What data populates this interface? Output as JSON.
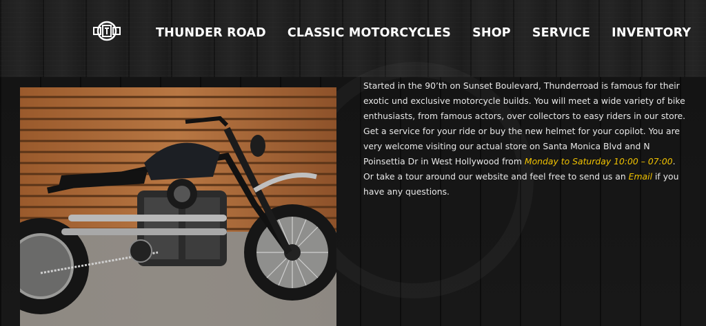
{
  "nav": {
    "items": [
      {
        "label": "THUNDER ROAD"
      },
      {
        "label": "CLASSIC MOTORCYCLES"
      },
      {
        "label": "SHOP"
      },
      {
        "label": "SERVICE"
      },
      {
        "label": "INVENTORY"
      }
    ]
  },
  "logo": {
    "icon": "thunderroad-crest-icon"
  },
  "photo": {
    "subject": "motorcycle-photo"
  },
  "intro": {
    "part1": "Started in the 90’th on Sunset Boulevard, Thunderroad is famous for their exotic und exclusive motorcycle builds. You will meet a wide variety of bike enthusiasts, from famous actors, over collectors to easy riders in our store. Get a service for your ride or buy the new helmet for your copilot. You are very welcome visiting our actual store on Santa Monica Blvd and N Poinsettia Dr in West Hollywood from ",
    "hours": "Monday to Saturday 10:00 – 07:00",
    "part2": ". Or take a tour around our website and feel free to send us an ",
    "email_link": "Email",
    "part3": " if you have any questions."
  },
  "colors": {
    "accent": "#f2c300",
    "text": "#e8e8e8",
    "nav": "#ffffff"
  }
}
